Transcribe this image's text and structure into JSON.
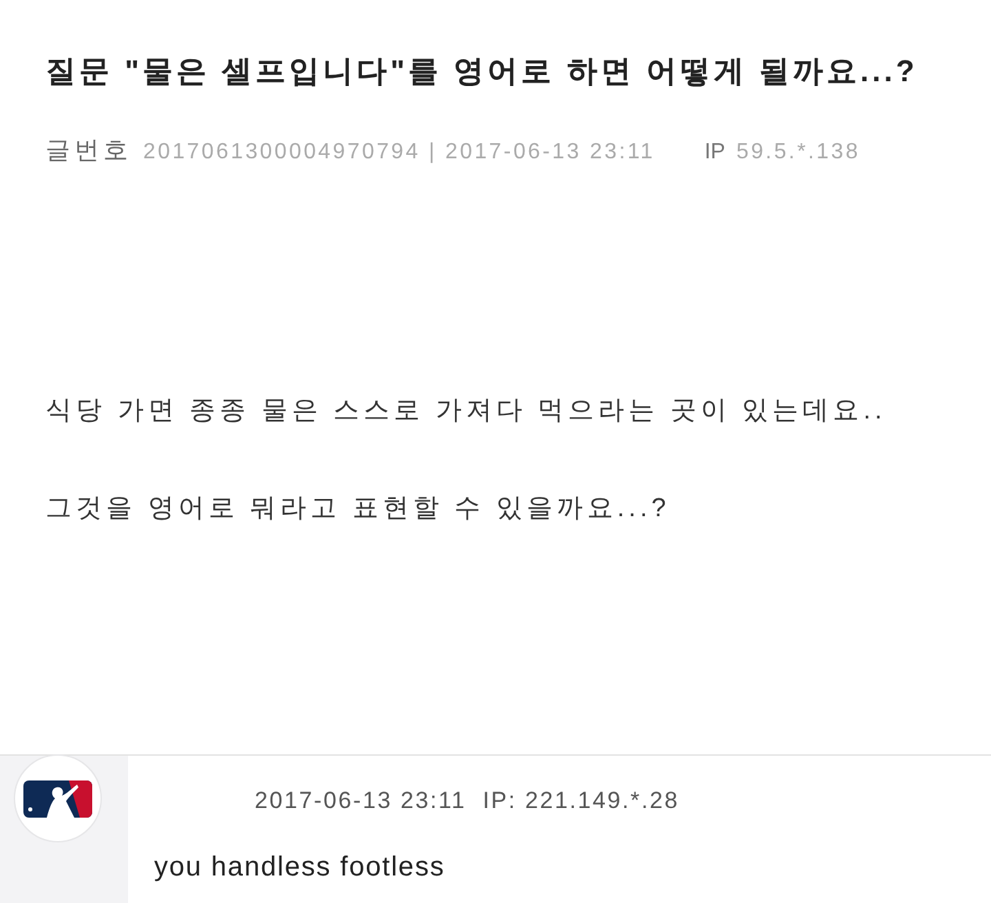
{
  "post": {
    "title": "질문 \"물은 셀프입니다\"를 영어로 하면 어떻게 될까요...?",
    "number_label": "글번호",
    "number_and_date": "2017061300004970794 | 2017-06-13 23:11",
    "ip_label": "IP",
    "ip": "59.5.*.138"
  },
  "body": [
    "식당 가면 종종 물은 스스로 가져다 먹으라는 곳이 있는데요..",
    "그것을 영어로 뭐라고 표현할 수 있을까요...?"
  ],
  "comment": {
    "date": "2017-06-13 23:11",
    "ip": "IP: 221.149.*.28",
    "text": "you handless footless"
  }
}
